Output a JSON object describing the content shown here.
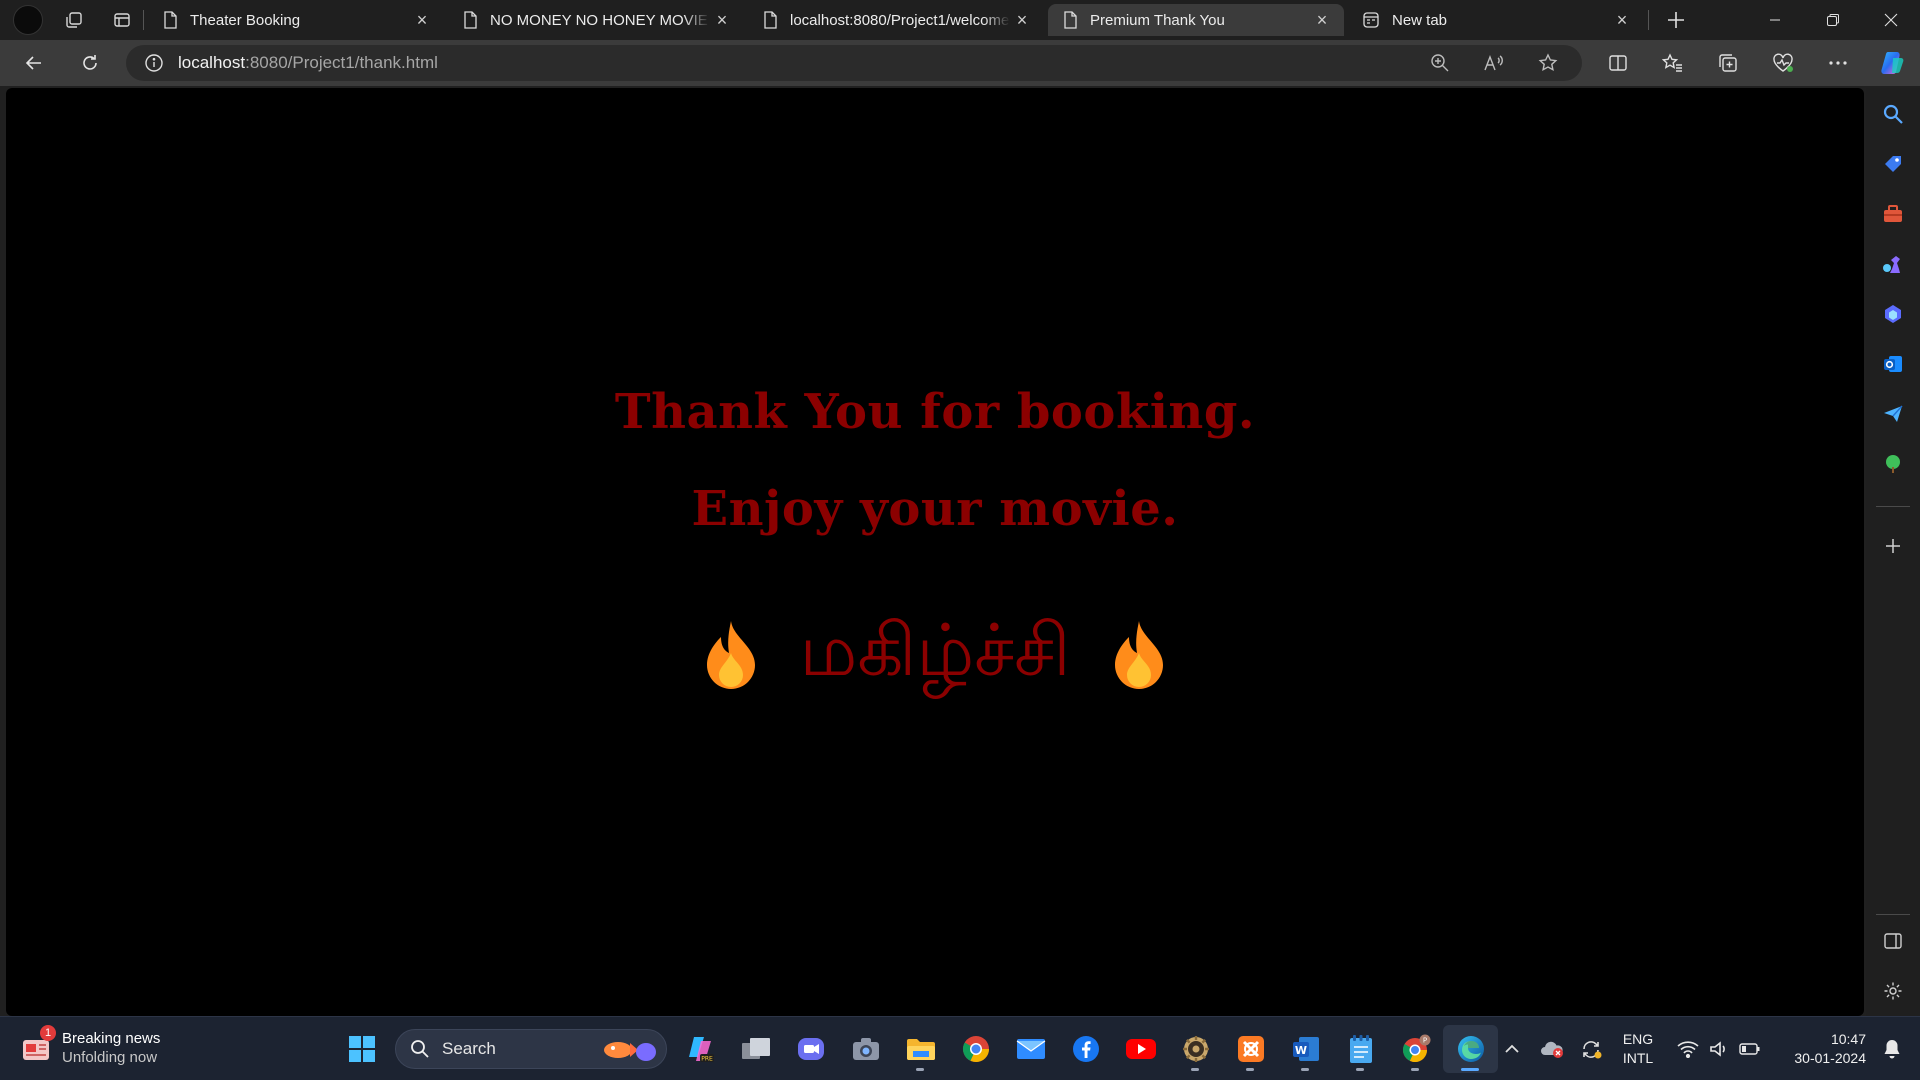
{
  "tabs": [
    {
      "title": "Theater Booking",
      "active": false
    },
    {
      "title": "NO MONEY NO HONEY MOVIE F",
      "active": false
    },
    {
      "title": "localhost:8080/Project1/welcome",
      "active": false
    },
    {
      "title": "Premium Thank You",
      "active": true
    },
    {
      "title": "New tab",
      "active": false
    }
  ],
  "address": {
    "host": "localhost",
    "path": ":8080/Project1/thank.html"
  },
  "page": {
    "line1": "Thank You for booking.",
    "line2": "Enjoy your movie.",
    "tamil": "மகிழ்ச்சி"
  },
  "taskbar": {
    "news_badge": "1",
    "news_title": "Breaking news",
    "news_sub": "Unfolding now",
    "search_label": "Search",
    "lang_line1": "ENG",
    "lang_line2": "INTL",
    "time": "10:47",
    "date": "30-01-2024"
  },
  "colors": {
    "accent_red": "#8b0000",
    "page_bg": "#000000",
    "chrome_bg": "#3b3b3b"
  }
}
